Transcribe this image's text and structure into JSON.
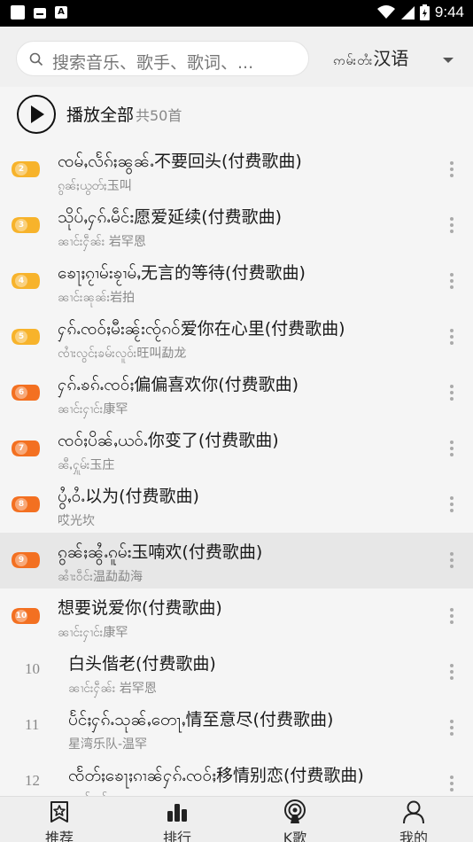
{
  "status_bar": {
    "time": "9:44"
  },
  "search": {
    "placeholder": "搜索音乐、歌手、歌词、..."
  },
  "language": {
    "script_label": "ဢမ်းတႆး",
    "label": "汉语"
  },
  "play_all": {
    "label": "播放全部",
    "count": "共50首"
  },
  "songs": [
    {
      "rank": "2",
      "title": "ၸမ်ႇလႅၵ်ႈၼွၼ်ႉ不要回头(付费歌曲)",
      "artist": "ၵွၼ်ႈယွတ်ႈ玉叫",
      "badge_color": "#f7b32b",
      "style": "badge",
      "highlight": false
    },
    {
      "rank": "3",
      "title": "သိုပ်ႇႁၵ်ႉမဵင်း愿爱延续(付费歌曲)",
      "artist": "ၼၢင်းႁဵၼ်း 岩罕恩",
      "badge_color": "#f7b32b",
      "style": "badge",
      "highlight": false
    },
    {
      "rank": "4",
      "title": "ၶေႃႈၵႂၢမ်းၶႂၢမ်ႇ无言的等待(付费歌曲)",
      "artist": "ၼၢင်းၼုၼ်း岩拍",
      "badge_color": "#f7b32b",
      "style": "badge",
      "highlight": false
    },
    {
      "rank": "5",
      "title": "ႁၵ်ႉၸဝ်ႈမီးၼႂ်းၸႂ်ၵဝ်爱你在心里(付费歌曲)",
      "artist": "ၸၢႆးလွင်ႈၶမ်းလူဝ်း旺叫勐龙",
      "badge_color": "#f7b32b",
      "style": "badge",
      "highlight": false
    },
    {
      "rank": "6",
      "title": "ႁၵ်ႉၶၵ်ႉၸဝ်ႈ偏偏喜欢你(付费歌曲)",
      "artist": "ၼၢင်းႁၢင်း康罕",
      "badge_color": "#f37021",
      "style": "badge",
      "highlight": false
    },
    {
      "rank": "7",
      "title": "ၸဝ်ႈပိၼ်ႇယဝ်ႉ你变了(付费歌曲)",
      "artist": "ၼီႇႁူမ်း玉庄",
      "badge_color": "#f37021",
      "style": "badge",
      "highlight": false
    },
    {
      "rank": "8",
      "title": "ပွႆႇဝႆႉ以为(付费歌曲)",
      "artist": "哎光坎",
      "badge_color": "#f37021",
      "style": "badge",
      "highlight": false
    },
    {
      "rank": "9",
      "title": "ၵွၼ်ႈၼွႆႉၵူမ်း玉喃欢(付费歌曲)",
      "artist": "ၼၢႆးဝဵင်း温勐勐海",
      "badge_color": "#f37021",
      "style": "badge",
      "highlight": true
    },
    {
      "rank": "10",
      "title": "想要说爱你(付费歌曲)",
      "artist": "ၼၢင်းႁၢင်း康罕",
      "badge_color": "#f37021",
      "style": "badge",
      "highlight": false
    },
    {
      "rank": "10",
      "title": "白头偕老(付费歌曲)",
      "artist": "ၼၢင်းႁဵၼ်း 岩罕恩",
      "badge_color": "",
      "style": "plain",
      "highlight": false
    },
    {
      "rank": "11",
      "title": "ပႅင်ႈႁၵ်ႉသုၼ်ႇတေႃႇ情至意尽(付费歌曲)",
      "artist": "星湾乐队-温罕",
      "badge_color": "",
      "style": "plain",
      "highlight": false
    },
    {
      "rank": "12",
      "title": "ၸႅတ်ႈၶေႃႈၵၢၼ်ႁၵ်ႉၸဝ်ႈ移情别恋(付费歌曲)",
      "artist": "ၼၢင်းၶမ်း",
      "badge_color": "",
      "style": "plain",
      "highlight": false
    }
  ],
  "tabs": [
    {
      "label": "推荐",
      "icon": "recommend-star-icon"
    },
    {
      "label": "排行",
      "icon": "ranking-bars-icon"
    },
    {
      "label": "K歌",
      "icon": "karaoke-broadcast-icon"
    },
    {
      "label": "我的",
      "icon": "profile-person-icon"
    }
  ]
}
